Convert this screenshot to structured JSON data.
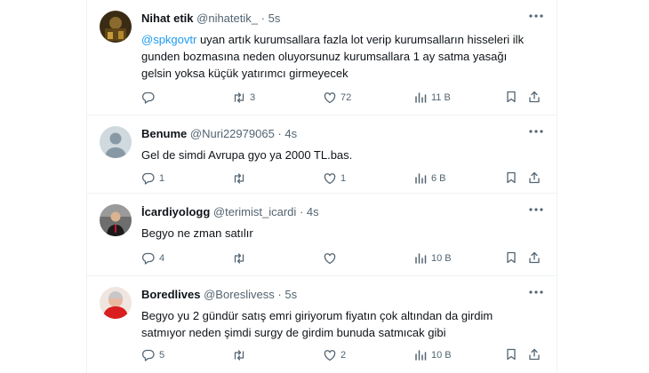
{
  "tweets": [
    {
      "name": "Nihat etik",
      "handle": "@nihatetik_",
      "time": "5s",
      "mention": "@spkgovtr",
      "text": " uyan artık kurumsallara fazla lot verip kurumsalların hisseleri ilk gunden bozmasına neden oluyorsunuz kurumsallara 1 ay satma yasağı gelsin yoksa küçük yatırımcı girmeyecek",
      "replies": "",
      "retweets": "3",
      "likes": "72",
      "views": "11 B"
    },
    {
      "name": "Benume",
      "handle": "@Nuri22979065",
      "time": "4s",
      "text": "Gel de simdi Avrupa gyo ya 2000 TL.bas.",
      "replies": "1",
      "retweets": "",
      "likes": "1",
      "views": "6 B"
    },
    {
      "name": "İcardiyologg",
      "handle": "@terimist_icardi",
      "time": "4s",
      "text": "Begyo ne zman satılır",
      "replies": "4",
      "retweets": "",
      "likes": "",
      "views": "10 B"
    },
    {
      "name": "Boredlives",
      "handle": "@Boreslivess",
      "time": "5s",
      "text": "Begyo yu 2 gündür satış emri giriyorum fiyatın çok altından da girdim satmıyor neden şimdi surgy de girdim bunuda satmıcak gibi",
      "replies": "5",
      "retweets": "",
      "likes": "2",
      "views": "10 B"
    }
  ],
  "separator": "·",
  "colors": {
    "text": "#0f1419",
    "muted": "#536471",
    "link": "#1d9bf0",
    "border": "#eff3f4"
  },
  "icons": [
    "more-icon",
    "reply-icon",
    "retweet-icon",
    "like-icon",
    "views-icon",
    "bookmark-icon",
    "share-icon"
  ]
}
